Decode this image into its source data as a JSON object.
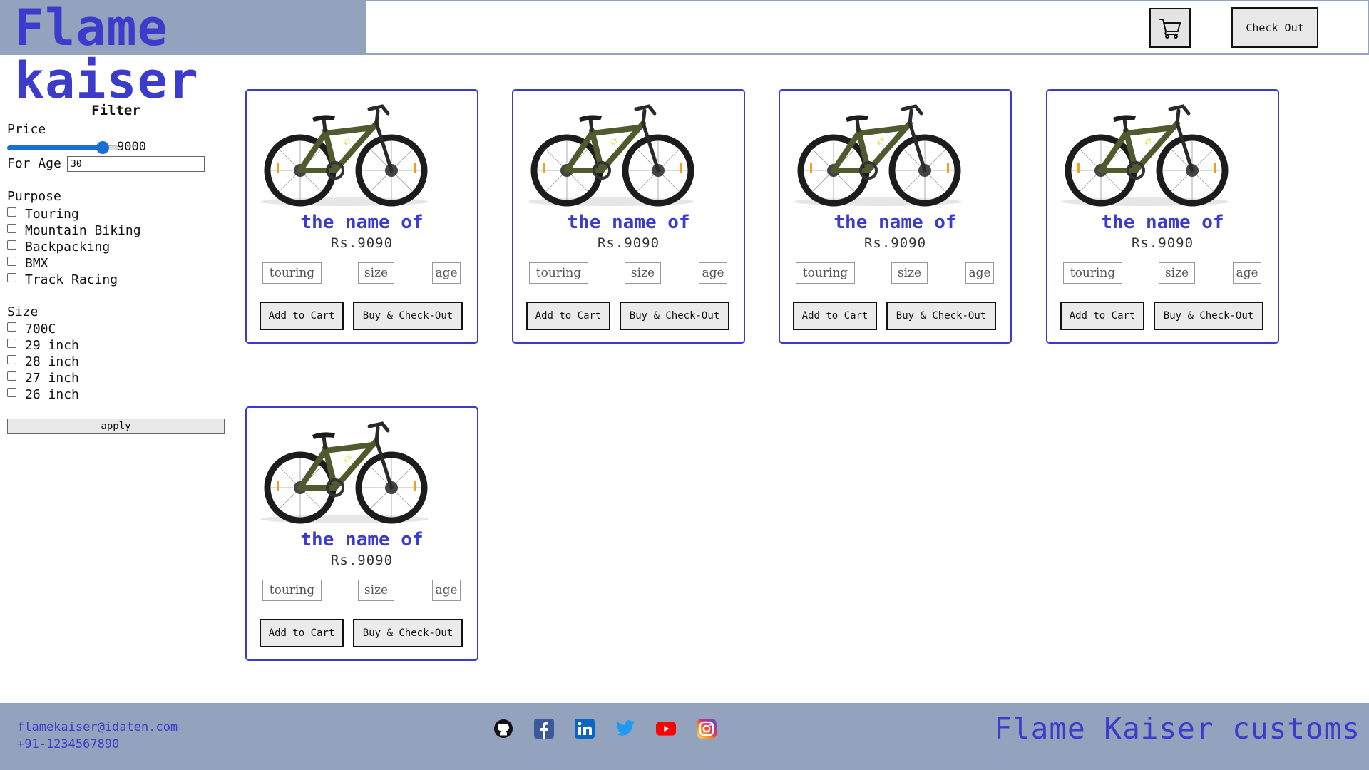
{
  "header": {
    "brand": "Flame kaiser",
    "cart_icon": "cart-icon",
    "checkout_label": "Check Out"
  },
  "filter": {
    "title": "Filter",
    "price_label": "Price",
    "price_value": "9000",
    "price_slider_fraction": 0.86,
    "age_label": "For Age",
    "age_value": "30",
    "purpose_label": "Purpose",
    "purpose_options": [
      "Touring",
      "Mountain Biking",
      "Backpacking",
      "BMX",
      "Track Racing"
    ],
    "size_label": "Size",
    "size_options": [
      "700C",
      "29 inch",
      "28 inch",
      "27 inch",
      "26 inch"
    ],
    "apply_label": "apply"
  },
  "products": [
    {
      "name": "the name of",
      "price": "Rs.9090",
      "tag1": "touring",
      "tag2": "size",
      "tag3": "age",
      "add_label": "Add to Cart",
      "buy_label": "Buy & Check-Out"
    },
    {
      "name": "the name of",
      "price": "Rs.9090",
      "tag1": "touring",
      "tag2": "size",
      "tag3": "age",
      "add_label": "Add to Cart",
      "buy_label": "Buy & Check-Out"
    },
    {
      "name": "the name of",
      "price": "Rs.9090",
      "tag1": "touring",
      "tag2": "size",
      "tag3": "age",
      "add_label": "Add to Cart",
      "buy_label": "Buy & Check-Out"
    },
    {
      "name": "the name of",
      "price": "Rs.9090",
      "tag1": "touring",
      "tag2": "size",
      "tag3": "age",
      "add_label": "Add to Cart",
      "buy_label": "Buy & Check-Out"
    },
    {
      "name": "the name of",
      "price": "Rs.9090",
      "tag1": "touring",
      "tag2": "size",
      "tag3": "age",
      "add_label": "Add to Cart",
      "buy_label": "Buy & Check-Out"
    }
  ],
  "footer": {
    "email": "flamekaiser@idaten.com",
    "phone": "+91-1234567890",
    "tagline": "Flame Kaiser customs",
    "social_icons": [
      "github-icon",
      "facebook-icon",
      "linkedin-icon",
      "twitter-icon",
      "youtube-icon",
      "instagram-icon"
    ]
  },
  "colors": {
    "brand": "#3b3bcc",
    "header_bg": "#94a3bd",
    "slider": "#1a6fd6"
  }
}
